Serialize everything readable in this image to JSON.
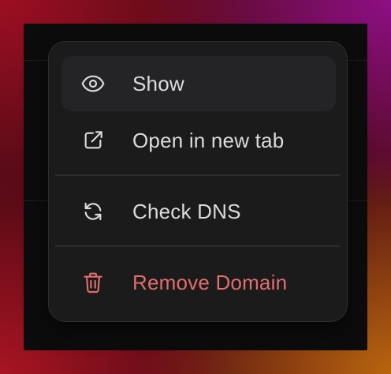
{
  "menu": {
    "items": [
      {
        "label": "Show",
        "icon": "eye-icon"
      },
      {
        "label": "Open in new tab",
        "icon": "external-link-icon"
      },
      {
        "label": "Check DNS",
        "icon": "refresh-icon"
      },
      {
        "label": "Remove Domain",
        "icon": "trash-icon"
      }
    ]
  },
  "colors": {
    "menu_background": "#1b1b1c",
    "menu_border": "#2e2e30",
    "hover_background": "#242426",
    "text": "#dcdcde",
    "danger": "#e16d6d"
  }
}
